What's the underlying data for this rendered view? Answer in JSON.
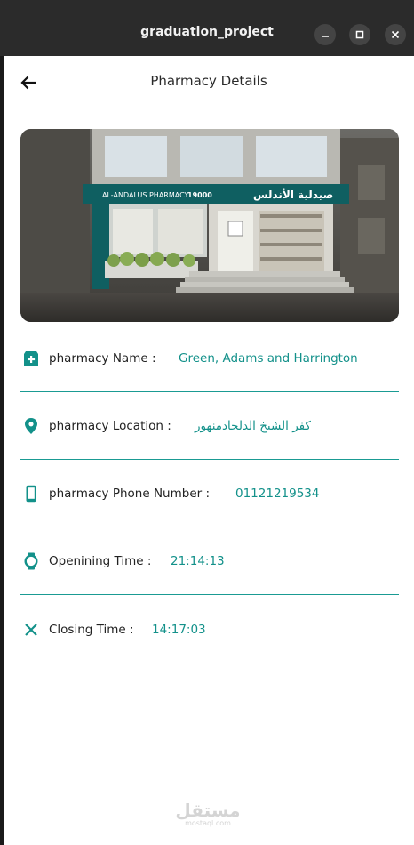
{
  "window": {
    "title": "graduation_project",
    "controls": {
      "minimize": "–",
      "maximize": "□",
      "close": "✕"
    }
  },
  "appbar": {
    "title": "Pharmacy Details",
    "back_icon": "arrow-left-icon"
  },
  "photo": {
    "sign_latin": "AL-ANDALUS PHARMACY",
    "sign_number": "19000",
    "sign_arabic": "صيدلية الأندلس"
  },
  "details": {
    "name": {
      "label": "pharmacy Name :",
      "value": "Green, Adams and Harrington",
      "icon": "add-business-icon"
    },
    "location": {
      "label": "pharmacy Location :",
      "value": "كفر الشيخ الدلجادمنهور",
      "icon": "location-pin-icon"
    },
    "phone": {
      "label": "pharmacy Phone Number :",
      "value": "01121219534",
      "icon": "phone-icon"
    },
    "opening": {
      "label": "Openining Time :",
      "value": "21:14:13",
      "icon": "watch-icon"
    },
    "closing": {
      "label": "Closing Time :",
      "value": "14:17:03",
      "icon": "close-x-icon"
    }
  },
  "watermark": {
    "arabic": "مستقل",
    "latin": "mostaql.com"
  },
  "colors": {
    "accent": "#13918a",
    "titlebar": "#2b2b2b",
    "background": "#ffffff"
  }
}
